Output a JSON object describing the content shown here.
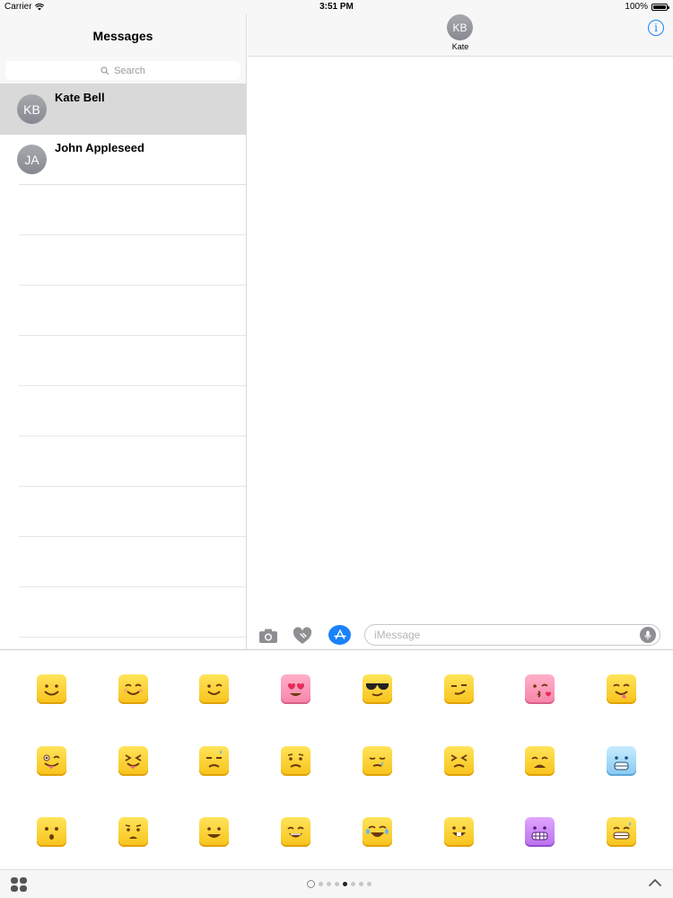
{
  "statusbar": {
    "carrier": "Carrier",
    "time": "3:51 PM",
    "battery": "100%",
    "battery_level": 1.0
  },
  "sidebar": {
    "title": "Messages",
    "search_placeholder": "Search",
    "conversations": [
      {
        "initials": "KB",
        "name": "Kate Bell",
        "selected": true
      },
      {
        "initials": "JA",
        "name": "John Appleseed",
        "selected": false
      }
    ]
  },
  "conversation": {
    "initials": "KB",
    "name": "Kate"
  },
  "composer": {
    "placeholder": "iMessage"
  },
  "stickers": [
    {
      "id": "smile",
      "color": "yellow"
    },
    {
      "id": "blush",
      "color": "yellow"
    },
    {
      "id": "wink",
      "color": "yellow"
    },
    {
      "id": "heart-eyes",
      "color": "pink"
    },
    {
      "id": "sunglasses",
      "color": "yellow"
    },
    {
      "id": "smirk",
      "color": "yellow"
    },
    {
      "id": "kiss",
      "color": "pink"
    },
    {
      "id": "yum",
      "color": "yellow"
    },
    {
      "id": "tongue-wink",
      "color": "yellow"
    },
    {
      "id": "tongue-squint",
      "color": "yellow"
    },
    {
      "id": "sweat-sad",
      "color": "yellow"
    },
    {
      "id": "worried",
      "color": "yellow"
    },
    {
      "id": "sleepy",
      "color": "yellow"
    },
    {
      "id": "persevere",
      "color": "yellow"
    },
    {
      "id": "weary",
      "color": "yellow"
    },
    {
      "id": "cold",
      "color": "blue"
    },
    {
      "id": "surprised",
      "color": "yellow"
    },
    {
      "id": "astonished",
      "color": "yellow"
    },
    {
      "id": "grin",
      "color": "yellow"
    },
    {
      "id": "happy",
      "color": "yellow"
    },
    {
      "id": "joy",
      "color": "yellow"
    },
    {
      "id": "bucktooth",
      "color": "yellow"
    },
    {
      "id": "grimace",
      "color": "purple"
    },
    {
      "id": "sweat-grin",
      "color": "yellow"
    }
  ],
  "pager": {
    "pages": 7,
    "active": 3
  }
}
